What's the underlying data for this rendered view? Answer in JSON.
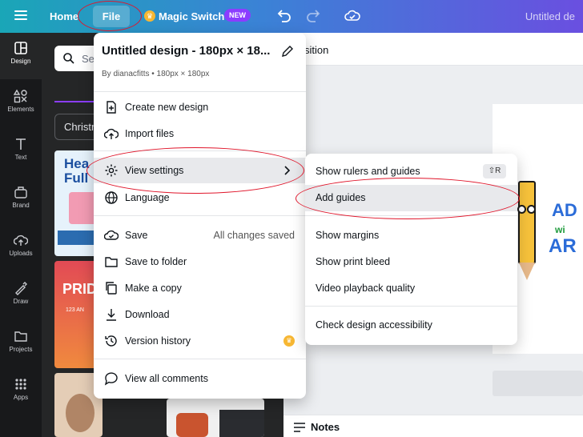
{
  "topbar": {
    "home": "Home",
    "file": "File",
    "magic_switch": "Magic Switch",
    "new_badge": "NEW",
    "doc_title_right": "Untitled de"
  },
  "rail": [
    {
      "label": "Design",
      "icon": "layout-icon"
    },
    {
      "label": "Elements",
      "icon": "shapes-icon"
    },
    {
      "label": "Text",
      "icon": "text-icon"
    },
    {
      "label": "Brand",
      "icon": "brand-icon"
    },
    {
      "label": "Uploads",
      "icon": "upload-icon"
    },
    {
      "label": "Draw",
      "icon": "draw-icon"
    },
    {
      "label": "Projects",
      "icon": "folder-icon"
    },
    {
      "label": "Apps",
      "icon": "apps-icon"
    }
  ],
  "panel": {
    "search_placeholder": "Se",
    "chip": "Christm",
    "thumb1_text": "Hea Full",
    "thumb2_text": "PRID",
    "thumb2_sub": "123 AN"
  },
  "canvas": {
    "position_label": "sition",
    "notes_label": "Notes"
  },
  "file_menu": {
    "title": "Untitled design - 180px × 18...",
    "subtitle": "By dianacfitts • 180px × 180px",
    "items": [
      {
        "label": "Create new design",
        "icon": "plus-page-icon"
      },
      {
        "label": "Import files",
        "icon": "cloud-upload-icon"
      },
      {
        "label": "View settings",
        "icon": "gear-icon"
      },
      {
        "label": "Language",
        "icon": "globe-icon"
      },
      {
        "label": "Save",
        "icon": "check-circle-icon",
        "right": "All changes saved"
      },
      {
        "label": "Save to folder",
        "icon": "folder-icon"
      },
      {
        "label": "Make a copy",
        "icon": "copy-icon"
      },
      {
        "label": "Download",
        "icon": "download-icon"
      },
      {
        "label": "Version history",
        "icon": "history-icon"
      },
      {
        "label": "View all comments",
        "icon": "comment-icon"
      }
    ]
  },
  "sub_menu": {
    "shortcut": "⇧R",
    "items": [
      {
        "label": "Show rulers and guides"
      },
      {
        "label": "Add guides"
      },
      {
        "label": "Show margins"
      },
      {
        "label": "Show print bleed"
      },
      {
        "label": "Video playback quality"
      },
      {
        "label": "Check design accessibility"
      }
    ]
  },
  "colors": {
    "accent": "#8b3dff",
    "annotation": "#e0162b",
    "menu_highlight": "#e8e9ec"
  }
}
